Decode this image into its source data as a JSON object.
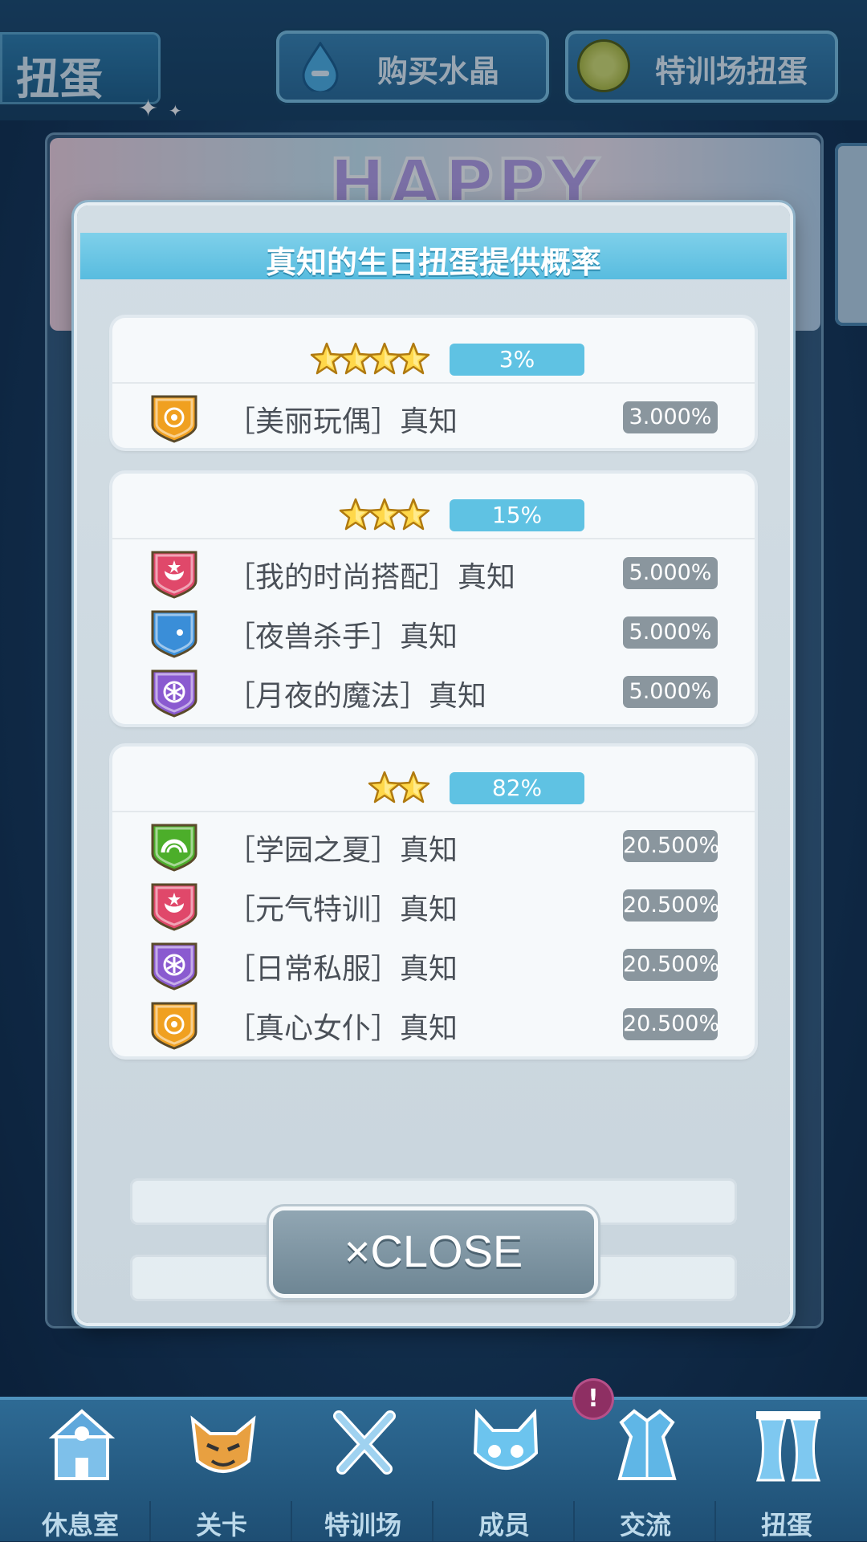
{
  "header": {
    "title": "扭蛋",
    "buy_crystal_label": "购买水晶",
    "training_gacha_label": "特训场扭蛋"
  },
  "banner": {
    "happy_text": "HAPPY"
  },
  "dialog": {
    "title": "真知的生日扭蛋提供概率",
    "groups": [
      {
        "stars": 4,
        "percent": "3%",
        "rows": [
          {
            "name": "［美丽玩偶］真知",
            "rate": "3.000%",
            "icon": "sun-attribute-icon",
            "color": "#f0a020"
          }
        ]
      },
      {
        "stars": 3,
        "percent": "15%",
        "rows": [
          {
            "name": "［我的时尚搭配］真知",
            "rate": "5.000%",
            "icon": "star-crescent-attribute-icon",
            "color": "#e0486a"
          },
          {
            "name": "［夜兽杀手］真知",
            "rate": "5.000%",
            "icon": "moon-attribute-icon",
            "color": "#3a8ed8"
          },
          {
            "name": "［月夜的魔法］真知",
            "rate": "5.000%",
            "icon": "flower-attribute-icon",
            "color": "#8a5ad0"
          }
        ]
      },
      {
        "stars": 2,
        "percent": "82%",
        "rows": [
          {
            "name": "［学园之夏］真知",
            "rate": "20.500%",
            "icon": "arc-attribute-icon",
            "color": "#4cae2a"
          },
          {
            "name": "［元气特训］真知",
            "rate": "20.500%",
            "icon": "star-crescent-attribute-icon",
            "color": "#e0486a"
          },
          {
            "name": "［日常私服］真知",
            "rate": "20.500%",
            "icon": "flower-attribute-icon",
            "color": "#8a5ad0"
          },
          {
            "name": "［真心女仆］真知",
            "rate": "20.500%",
            "icon": "sun-attribute-icon",
            "color": "#f0a020"
          }
        ]
      }
    ],
    "close_label": "×CLOSE"
  },
  "nav": {
    "items": [
      {
        "label": "休息室",
        "icon": "school-building-icon"
      },
      {
        "label": "关卡",
        "icon": "monster-mask-icon"
      },
      {
        "label": "特训场",
        "icon": "crossed-swords-icon"
      },
      {
        "label": "成员",
        "icon": "cat-girl-icon"
      },
      {
        "label": "交流",
        "icon": "dress-icon"
      },
      {
        "label": "扭蛋",
        "icon": "curtain-icon"
      }
    ],
    "badge": "!"
  },
  "colors": {
    "accent": "#5fc2e3",
    "rate_pill": "#8a969e",
    "nav_bg": "#2e6b95"
  }
}
